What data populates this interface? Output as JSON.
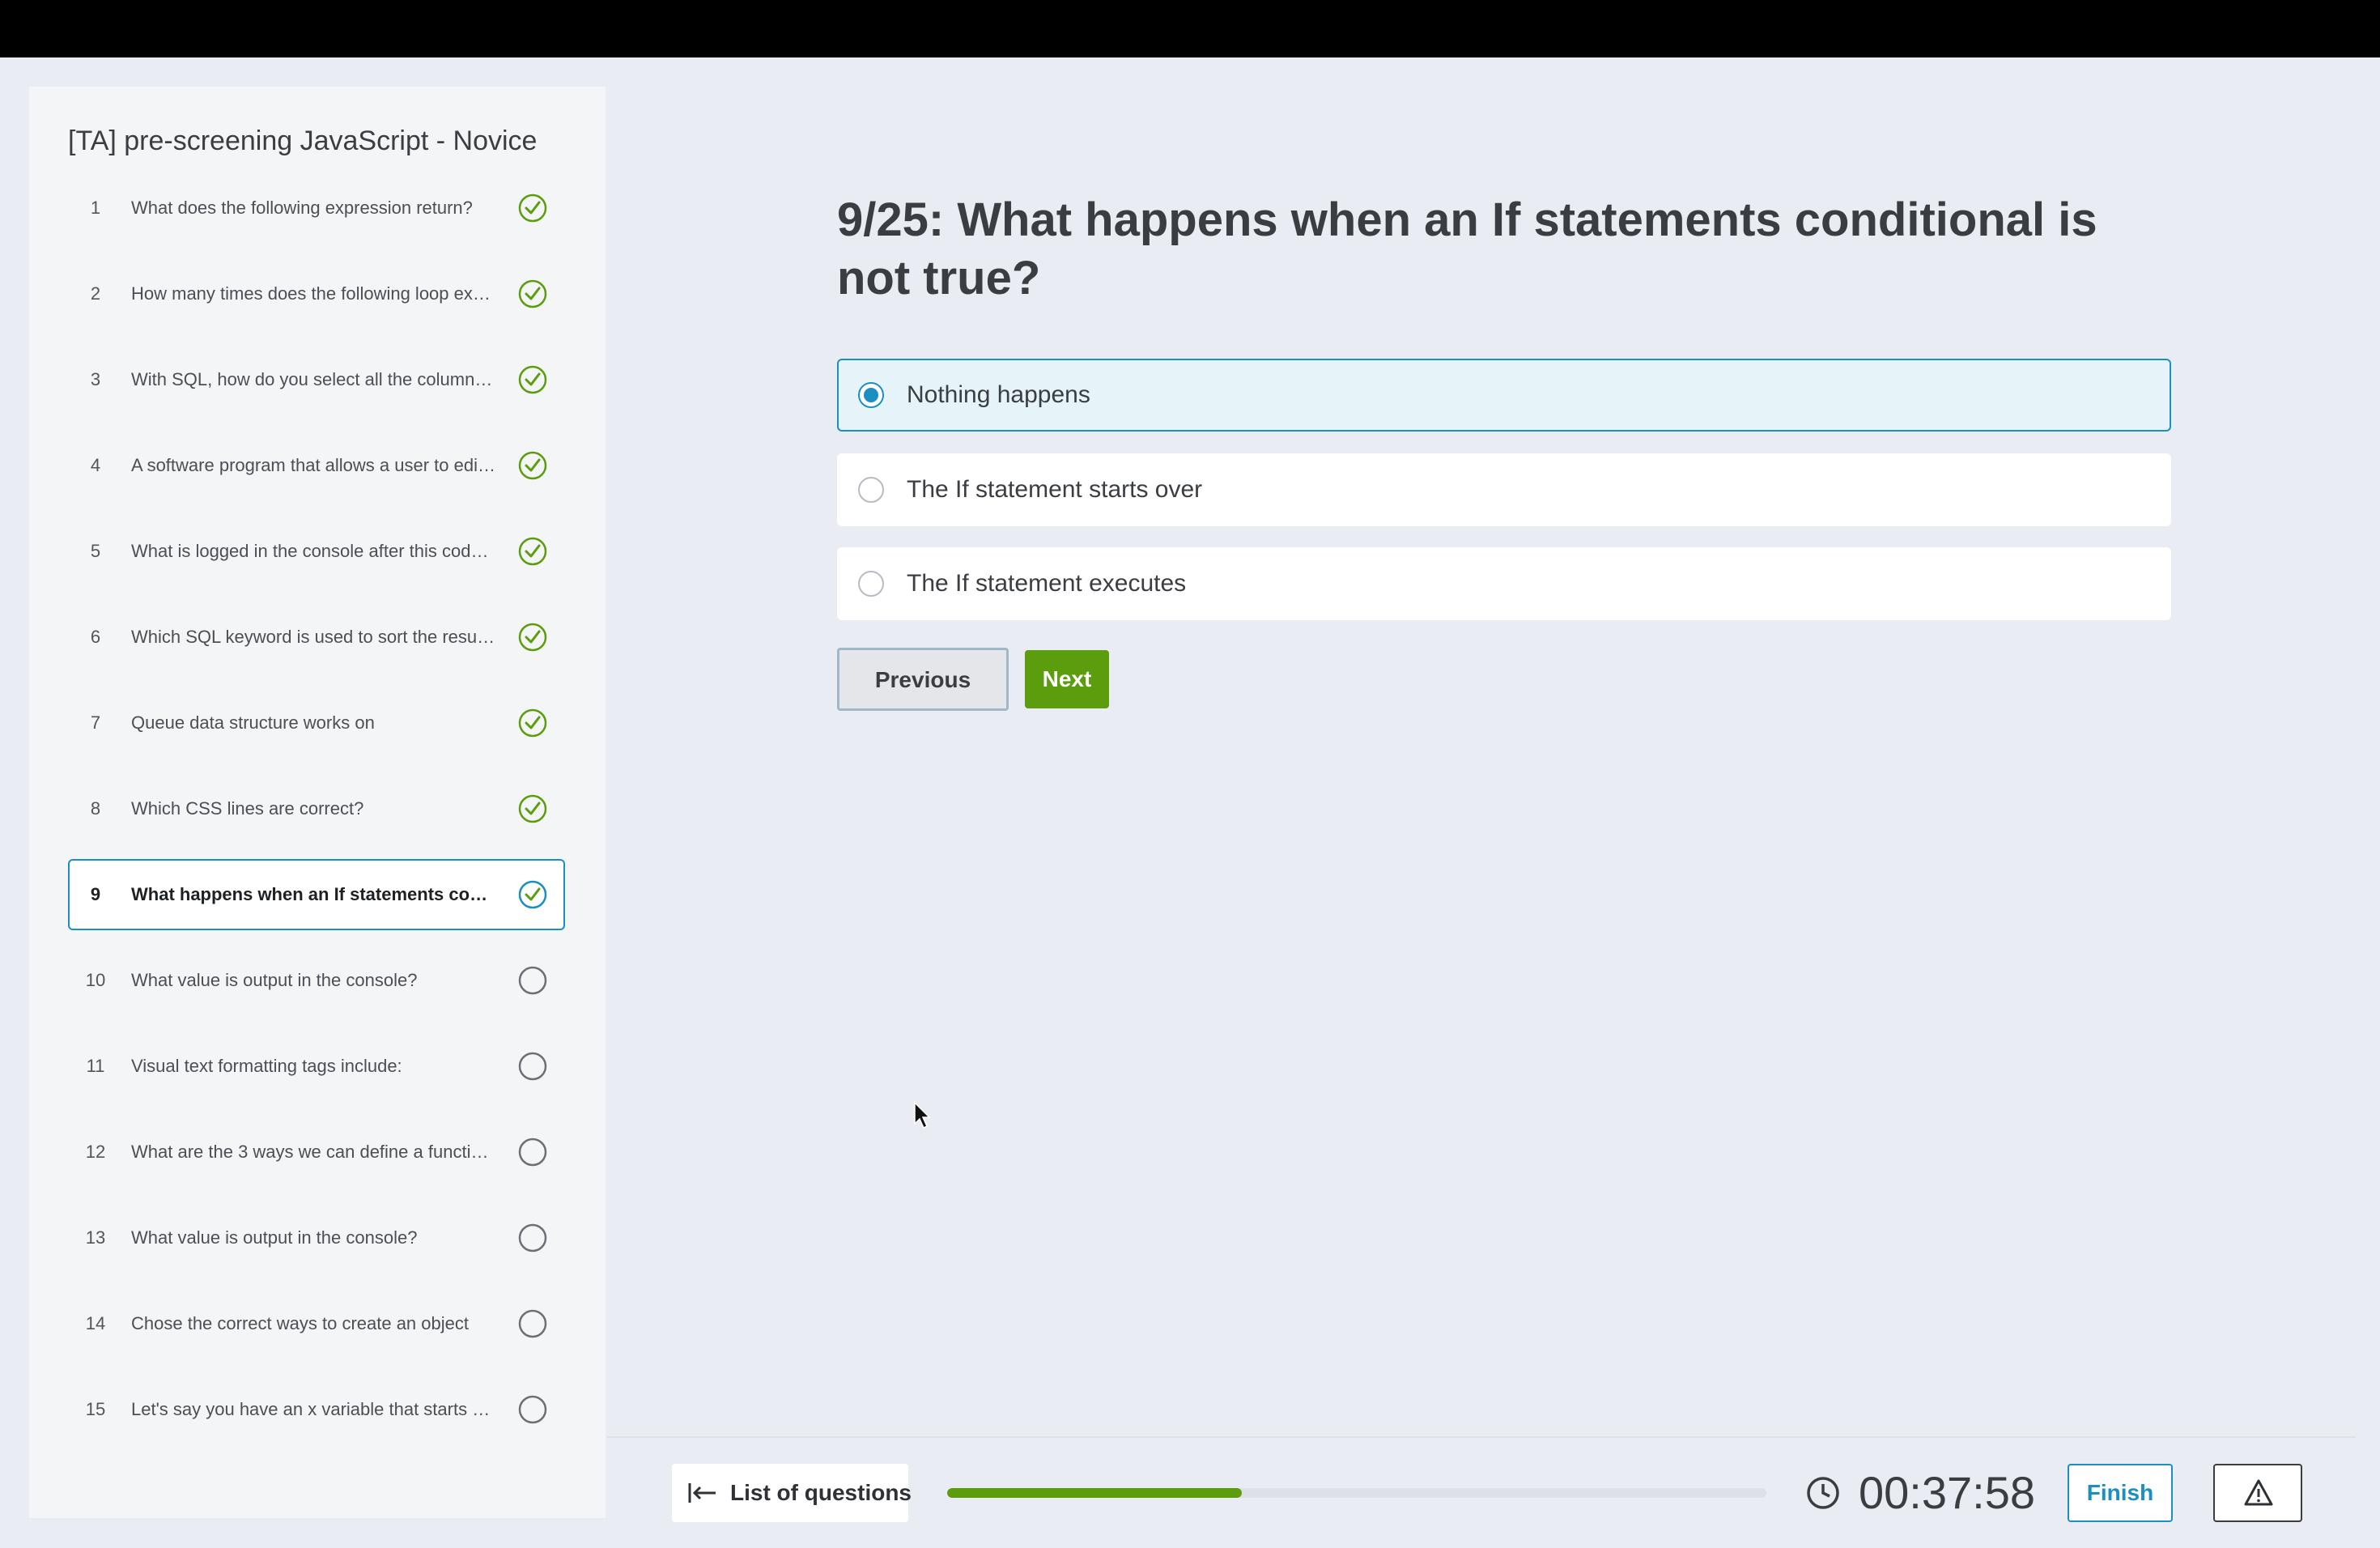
{
  "sidebar": {
    "title": "[TA] pre-screening JavaScript - Novice",
    "items": [
      {
        "num": "1",
        "text": "What does the following expression return?",
        "status": "answered"
      },
      {
        "num": "2",
        "text": "How many times does the following loop execute?",
        "status": "answered"
      },
      {
        "num": "3",
        "text": "With SQL, how do you select all the columns from a table?",
        "status": "answered"
      },
      {
        "num": "4",
        "text": "A software program that allows a user to edit code",
        "status": "answered"
      },
      {
        "num": "5",
        "text": "What is logged in the console after this code runs?",
        "status": "answered"
      },
      {
        "num": "6",
        "text": "Which SQL keyword is used to sort the result-set?",
        "status": "answered"
      },
      {
        "num": "7",
        "text": "Queue data structure works on",
        "status": "answered"
      },
      {
        "num": "8",
        "text": "Which CSS lines are correct?",
        "status": "answered"
      },
      {
        "num": "9",
        "text": "What happens when an If statements conditional is not true?",
        "status": "current"
      },
      {
        "num": "10",
        "text": "What value is output in the console?",
        "status": "unanswered"
      },
      {
        "num": "11",
        "text": "Visual text formatting tags include:",
        "status": "unanswered"
      },
      {
        "num": "12",
        "text": "What are the 3 ways we can define a function?",
        "status": "unanswered"
      },
      {
        "num": "13",
        "text": "What value is output in the console?",
        "status": "unanswered"
      },
      {
        "num": "14",
        "text": "Chose the correct ways to create an object",
        "status": "unanswered"
      },
      {
        "num": "15",
        "text": "Let's say you have an x variable that starts at 0",
        "status": "unanswered"
      }
    ]
  },
  "question": {
    "title": "9/25: What happens when an If statements conditional is not true?",
    "options": [
      {
        "label": "Nothing happens",
        "selected": true
      },
      {
        "label": "The If statement starts over",
        "selected": false
      },
      {
        "label": "The If statement executes",
        "selected": false
      }
    ]
  },
  "nav": {
    "previous_label": "Previous",
    "next_label": "Next"
  },
  "footer": {
    "list_label": "List of questions",
    "progress_fraction": 0.36,
    "timer": "00:37:58",
    "finish_label": "Finish"
  },
  "colors": {
    "accent": "#1b8fc2",
    "success": "#5b9d0c",
    "background": "#e9ecf2"
  },
  "icons": {
    "answered": "check-circle-icon",
    "current": "check-circle-icon",
    "unanswered": "empty-circle-icon",
    "list": "arrow-left-bar-icon",
    "clock": "clock-icon",
    "report": "warning-icon"
  }
}
